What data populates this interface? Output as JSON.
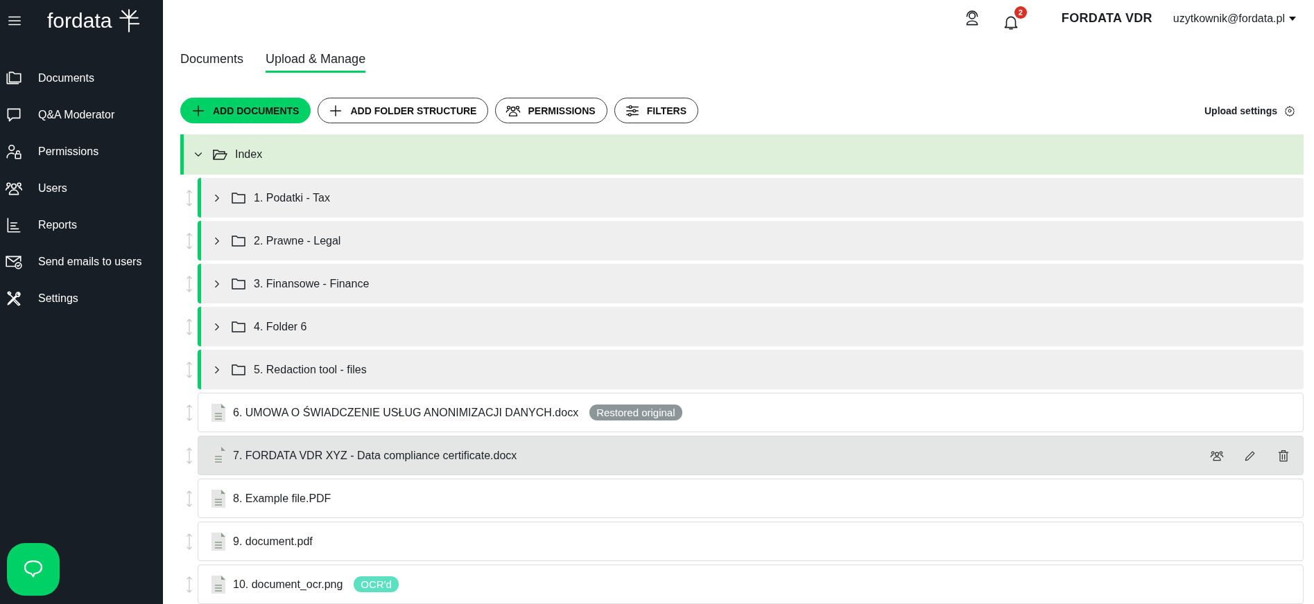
{
  "sidebar": {
    "logo": "fordata",
    "items": [
      {
        "label": "Documents"
      },
      {
        "label": "Q&A Moderator"
      },
      {
        "label": "Permissions"
      },
      {
        "label": "Users"
      },
      {
        "label": "Reports"
      },
      {
        "label": "Send emails to users"
      },
      {
        "label": "Settings"
      }
    ]
  },
  "header": {
    "notification_count": "2",
    "brand": "FORDATA VDR",
    "user": "uzytkownik@fordata.pl"
  },
  "tabs": [
    {
      "label": "Documents",
      "selected": false
    },
    {
      "label": "Upload & Manage",
      "selected": true
    }
  ],
  "toolbar": {
    "buttons": [
      {
        "label": "ADD DOCUMENTS",
        "kind": "primary"
      },
      {
        "label": "ADD FOLDER STRUCTURE",
        "kind": "outline"
      },
      {
        "label": "PERMISSIONS",
        "kind": "outline"
      },
      {
        "label": "FILTERS",
        "kind": "outline"
      }
    ],
    "upload_settings": "Upload settings"
  },
  "tree": {
    "root": {
      "label": "Index",
      "expanded": true
    },
    "items": [
      {
        "kind": "folder",
        "label": "1. Podatki - Tax",
        "expanded": false
      },
      {
        "kind": "folder",
        "label": "2. Prawne - Legal",
        "expanded": false
      },
      {
        "kind": "folder",
        "label": "3. Finansowe - Finance",
        "expanded": false
      },
      {
        "kind": "folder",
        "label": "4. Folder 6",
        "expanded": false
      },
      {
        "kind": "folder",
        "label": "5. Redaction tool - files",
        "expanded": false
      },
      {
        "kind": "file",
        "label": "6. UMOWA O ŚWIADCZENIE USŁUG ANONIMIZACJI DANYCH.docx",
        "highlighted": false,
        "badge": {
          "text": "Restored original",
          "color": "#8c9698"
        }
      },
      {
        "kind": "file",
        "label": "7. FORDATA VDR XYZ - Data compliance certificate.docx",
        "highlighted": true
      },
      {
        "kind": "file",
        "label": "8. Example file.PDF",
        "highlighted": false
      },
      {
        "kind": "file",
        "label": "9. document.pdf",
        "highlighted": false
      },
      {
        "kind": "file",
        "label": "10. document_ocr.png",
        "highlighted": false,
        "badge": {
          "text": "OCR'd",
          "color": "#5ce0c2"
        }
      }
    ]
  }
}
